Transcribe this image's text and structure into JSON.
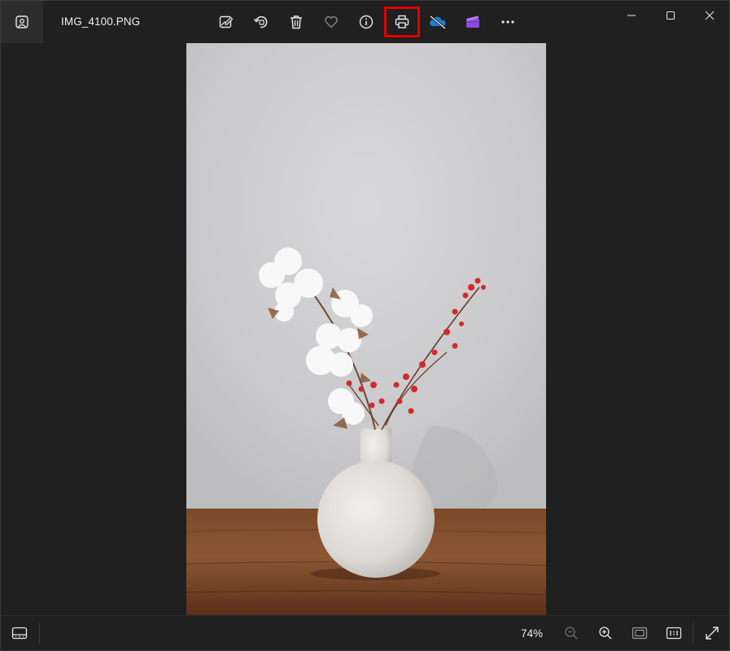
{
  "titlebar": {
    "file_name": "IMG_4100.PNG"
  },
  "toolbar": {
    "items": [
      {
        "name": "edit-image",
        "icon": "edit-image-icon"
      },
      {
        "name": "rotate",
        "icon": "rotate-icon"
      },
      {
        "name": "delete",
        "icon": "trash-icon"
      },
      {
        "name": "favorite",
        "icon": "heart-icon"
      },
      {
        "name": "info",
        "icon": "info-icon"
      },
      {
        "name": "print",
        "icon": "printer-icon",
        "highlighted": true
      },
      {
        "name": "onedrive",
        "icon": "onedrive-cloud-icon"
      },
      {
        "name": "clipchamp",
        "icon": "clipchamp-icon"
      },
      {
        "name": "more",
        "icon": "more-icon"
      }
    ]
  },
  "window_controls": [
    "minimize-icon",
    "maximize-icon",
    "close-icon"
  ],
  "status": {
    "zoom": "74%"
  },
  "colors": {
    "background": "#202020",
    "highlight_border": "#e00000",
    "onedrive_blue": "#1e7fd8",
    "clipchamp_purple": "#8a4be0",
    "berry_red": "#d42a2a"
  }
}
